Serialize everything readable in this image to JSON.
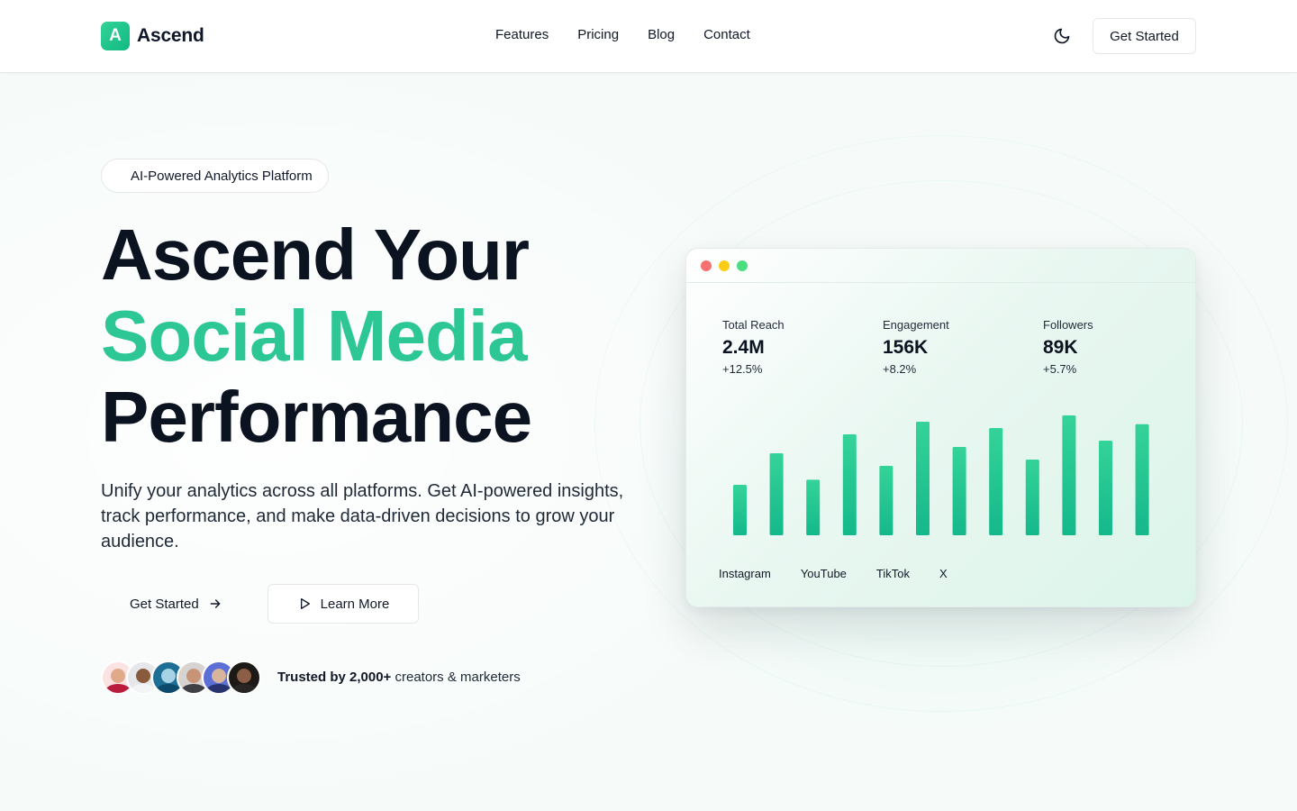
{
  "brand": {
    "logo_letter": "A",
    "name": "Ascend",
    "accent_color": "#2cc794"
  },
  "nav": {
    "items": [
      "Features",
      "Pricing",
      "Blog",
      "Contact"
    ]
  },
  "header": {
    "theme_icon": "moon-icon",
    "cta_label": "Get Started"
  },
  "hero": {
    "badge": "AI-Powered Analytics Platform",
    "headline_line1": "Ascend Your",
    "headline_line2": "Social Media",
    "headline_line3": "Performance",
    "subtext": "Unify your analytics across all platforms. Get AI-powered insights, track performance, and make data-driven decisions to grow your audience.",
    "primary_button": "Get Started",
    "secondary_button": "Learn More",
    "trust_bold": "Trusted by 2,000+",
    "trust_rest": " creators & marketers",
    "avatar_count": 6
  },
  "dashboard": {
    "window_dots": [
      "#f87171",
      "#facc15",
      "#4ade80"
    ],
    "stats": [
      {
        "label": "Total Reach",
        "value": "2.4M",
        "change": "+12.5%"
      },
      {
        "label": "Engagement",
        "value": "156K",
        "change": "+8.2%"
      },
      {
        "label": "Followers",
        "value": "89K",
        "change": "+5.7%"
      }
    ],
    "platforms": [
      "Instagram",
      "YouTube",
      "TikTok",
      "X"
    ]
  },
  "chart_data": {
    "type": "bar",
    "values": [
      40,
      65,
      44,
      80,
      55,
      90,
      70,
      85,
      60,
      95,
      75,
      88
    ],
    "ylim": [
      0,
      100
    ],
    "bar_color": "#2cc794"
  }
}
